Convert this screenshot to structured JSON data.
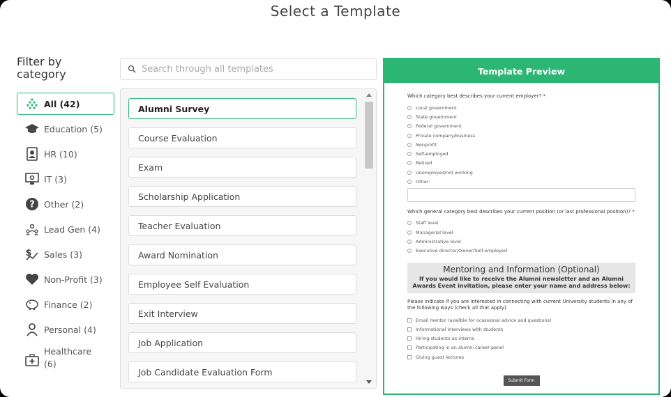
{
  "title": "Select a Template",
  "filter_heading": "Filter by category",
  "categories": [
    {
      "label": "All (42)",
      "icon": "tree-icon"
    },
    {
      "label": "Education (5)",
      "icon": "graduation-cap-icon"
    },
    {
      "label": "HR (10)",
      "icon": "id-badge-icon"
    },
    {
      "label": "IT (3)",
      "icon": "monitor-gear-icon"
    },
    {
      "label": "Other (2)",
      "icon": "question-circle-icon"
    },
    {
      "label": "Lead Gen (4)",
      "icon": "people-network-icon"
    },
    {
      "label": "Sales (3)",
      "icon": "dollar-chart-icon"
    },
    {
      "label": "Non-Profit (3)",
      "icon": "heart-icon"
    },
    {
      "label": "Finance (2)",
      "icon": "piggy-bank-icon"
    },
    {
      "label": "Personal (4)",
      "icon": "person-icon"
    },
    {
      "label": "Healthcare (6)",
      "icon": "medical-kit-icon"
    }
  ],
  "search": {
    "placeholder": "Search through all templates"
  },
  "templates": [
    "Alumni Survey",
    "Course Evaluation",
    "Exam",
    "Scholarship Application",
    "Teacher Evaluation",
    "Award Nomination",
    "Employee Self Evaluation",
    "Exit Interview",
    "Job Application",
    "Job Candidate Evaluation Form"
  ],
  "preview": {
    "header": "Template Preview",
    "q1": "Which category best describes your current employer? *",
    "q1_options": [
      "Local government",
      "State government",
      "Federal government",
      "Private company/business",
      "Nonprofit",
      "Self-employed",
      "Retired",
      "Unemployed/not working",
      "Other:"
    ],
    "q2": "Which general category best describes your current position (or last professional position)? *",
    "q2_options": [
      "Staff level",
      "Managerial level",
      "Administrative level",
      "Executive director/Owner/Self-employed"
    ],
    "section_title": "Mentoring and Information (Optional)",
    "section_desc": "If you would like to receive the Alumni newsletter and an Alumni Awards Event invitation, please enter your name and address below:",
    "q3": "Please indicate if you are interested in connecting with current University students in any of the following ways (check all that apply).",
    "q3_options": [
      "Email mentor (availble for ocassional advice and questions)",
      "Informational interviews with students",
      "Hiring students as interns",
      "Participating in an alumni career panel",
      "Giving guest lectures"
    ],
    "submit": "Submit Form"
  },
  "colors": {
    "accent": "#2bb673"
  }
}
